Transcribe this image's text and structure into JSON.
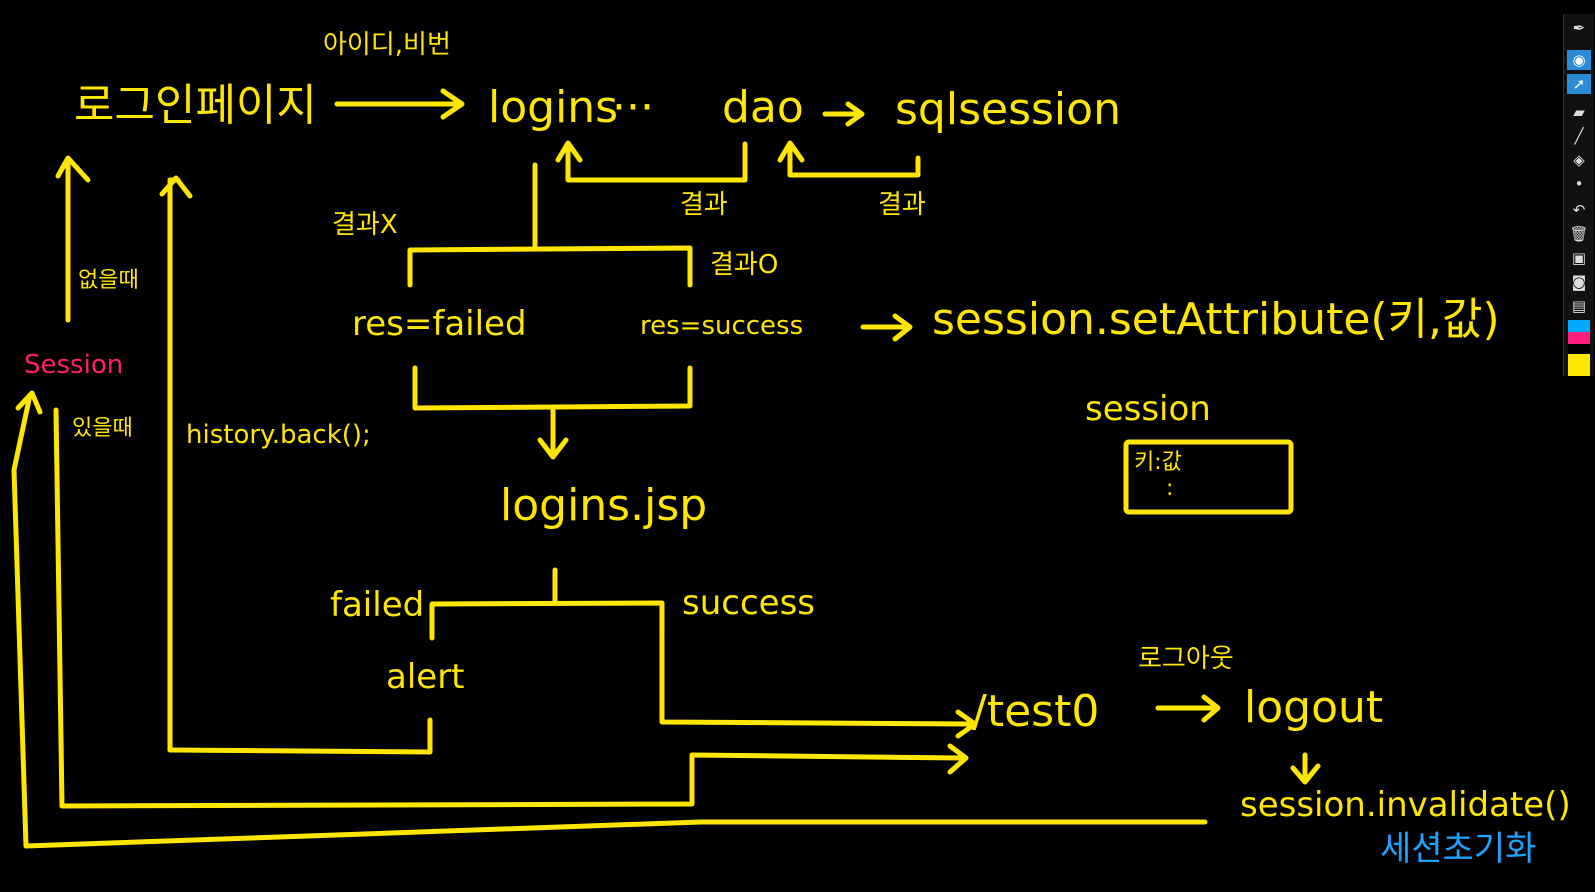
{
  "colors": {
    "ink": "#ffe600",
    "session_label": "#ff1e6e",
    "annotation_blue": "#1aa3ff",
    "background": "#000000"
  },
  "diagram": {
    "id_pw": "아이디,비번",
    "login_page": "로그인페이지",
    "logins": "logins",
    "dots": "···",
    "dao": "dao",
    "sqlsession": "sqlsession",
    "result_1": "결과",
    "result_2": "결과",
    "result_x": "결과X",
    "result_o": "결과O",
    "res_failed": "res=failed",
    "res_success": "res=success",
    "set_attribute": "session.setAttribute(키,값)",
    "session_box_title": "session",
    "session_box_line1": "키:값",
    "session_box_line2": ":",
    "when_absent": "없을때",
    "session_label": "Session",
    "when_present": "있을때",
    "history_back": "history.back();",
    "logins_jsp": "logins.jsp",
    "failed": "failed",
    "success": "success",
    "alert": "alert",
    "logout_ko": "로그아웃",
    "test0": "/test0",
    "logout": "logout",
    "invalidate": "session.invalidate()",
    "session_reset": "세션초기화"
  },
  "toolbar": {
    "tools": [
      {
        "icon": "pen-icon",
        "glyph": "✒"
      },
      {
        "icon": "eye-icon",
        "glyph": "◉"
      },
      {
        "icon": "cursor-icon",
        "glyph": "➚"
      },
      {
        "icon": "highlighter-icon",
        "glyph": "▰"
      },
      {
        "icon": "line-icon",
        "glyph": "╱"
      },
      {
        "icon": "eraser-icon",
        "glyph": "◈"
      },
      {
        "icon": "dot-icon",
        "glyph": "•"
      },
      {
        "icon": "undo-icon",
        "glyph": "↶"
      },
      {
        "icon": "trash-icon",
        "glyph": "🗑"
      },
      {
        "icon": "board-icon",
        "glyph": "▣"
      },
      {
        "icon": "camera-icon",
        "glyph": "◙"
      },
      {
        "icon": "clipboard-icon",
        "glyph": "▤"
      }
    ],
    "swatches": [
      "#00aaff",
      "#ff2080",
      "#000000",
      "#ffe600"
    ]
  }
}
